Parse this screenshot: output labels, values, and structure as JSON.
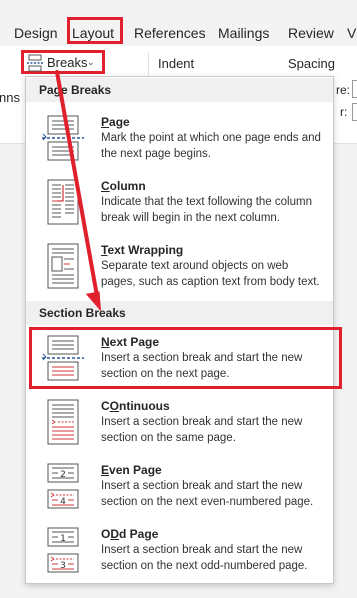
{
  "tabs": [
    {
      "label": "Design"
    },
    {
      "label": "Layout"
    },
    {
      "label": "References"
    },
    {
      "label": "Mailings"
    },
    {
      "label": "Review"
    },
    {
      "label": "Vi"
    }
  ],
  "ribbon": {
    "breaks_label": "Breaks",
    "indent_label": "Indent",
    "spacing_label": "Spacing",
    "columns_fragment": "nns",
    "before_fragment": "re:",
    "after_fragment": "r:"
  },
  "menu": {
    "page_breaks_heading": "Page Breaks",
    "section_breaks_heading": "Section Breaks",
    "page_breaks": [
      {
        "title": "Page",
        "underline": "P",
        "rest": "age",
        "desc": "Mark the point at which one page ends and the next page begins."
      },
      {
        "title": "Column",
        "underline": "C",
        "rest": "olumn",
        "desc": "Indicate that the text following the column break will begin in the next column."
      },
      {
        "title": "Text Wrapping",
        "underline": "T",
        "rest": "ext Wrapping",
        "desc": "Separate text around objects on web pages, such as caption text from body text."
      }
    ],
    "section_breaks": [
      {
        "title": "Next Page",
        "underline": "N",
        "rest": "ext Page",
        "desc": "Insert a section break and start the new section on the next page."
      },
      {
        "title": "Continuous",
        "underline": "O",
        "rest": "ntinuous",
        "prefix": "C",
        "desc": "Insert a section break and start the new section on the same page."
      },
      {
        "title": "Even Page",
        "underline": "E",
        "rest": "ven Page",
        "desc": "Insert a section break and start the new section on the next even-numbered page."
      },
      {
        "title": "Odd Page",
        "underline": "D",
        "rest": "d Page",
        "prefix": "O",
        "desc": "Insert a section break and start the new section on the next odd-numbered page."
      }
    ]
  },
  "icons": {
    "even_page_numbers": [
      "2",
      "4"
    ],
    "odd_page_numbers": [
      "1",
      "3"
    ]
  },
  "colors": {
    "annotation_red": "#e0202d",
    "icon_red": "#d13438",
    "icon_blue": "#2b5797"
  }
}
